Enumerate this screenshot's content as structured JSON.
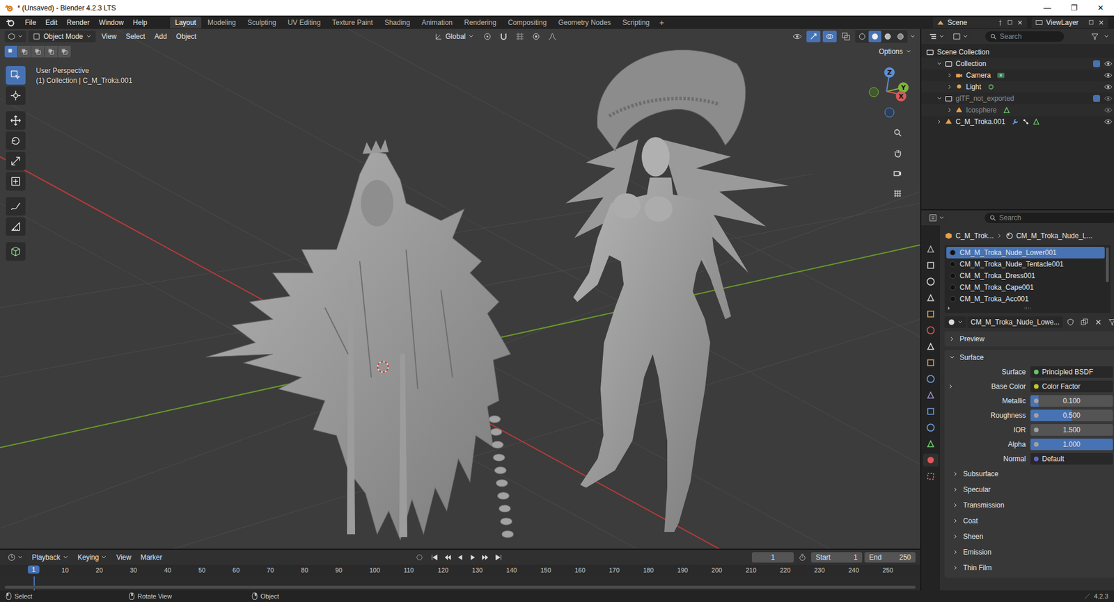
{
  "window": {
    "title": "* (Unsaved) - Blender 4.2.3 LTS",
    "controls": [
      "—",
      "❐",
      "✕"
    ]
  },
  "menus": [
    "File",
    "Edit",
    "Render",
    "Window",
    "Help"
  ],
  "workspaces": [
    {
      "label": "Layout",
      "selected": true
    },
    {
      "label": "Modeling",
      "selected": false
    },
    {
      "label": "Sculpting",
      "selected": false
    },
    {
      "label": "UV Editing",
      "selected": false
    },
    {
      "label": "Texture Paint",
      "selected": false
    },
    {
      "label": "Shading",
      "selected": false
    },
    {
      "label": "Animation",
      "selected": false
    },
    {
      "label": "Rendering",
      "selected": false
    },
    {
      "label": "Compositing",
      "selected": false
    },
    {
      "label": "Geometry Nodes",
      "selected": false
    },
    {
      "label": "Scripting",
      "selected": false
    }
  ],
  "workspace_add": "+",
  "scene": {
    "name": "Scene",
    "view_layer": "ViewLayer"
  },
  "viewport": {
    "mode": "Object Mode",
    "menus": [
      "View",
      "Select",
      "Add",
      "Object"
    ],
    "orientation": "Global",
    "options": "Options",
    "perspective": "User Perspective",
    "context": "(1) Collection | C_M_Troka.001",
    "gizmo": {
      "z": "Z",
      "y": "Y",
      "x": "X"
    },
    "tools": [
      {
        "selected": true
      },
      {
        "selected": false
      },
      {
        "selected": false
      },
      {
        "selected": false
      },
      {
        "selected": false
      },
      {
        "selected": false
      },
      {
        "selected": false
      },
      {
        "selected": false
      },
      {
        "selected": false
      }
    ],
    "select_modes": [
      {
        "selected": true
      },
      {
        "selected": false
      },
      {
        "selected": false
      },
      {
        "selected": false
      },
      {
        "selected": false
      }
    ],
    "shading": [
      {
        "selected": false
      },
      {
        "selected": true
      },
      {
        "selected": false
      },
      {
        "selected": false
      }
    ]
  },
  "timeline": {
    "menus": [
      "Playback",
      "Keying",
      "View",
      "Marker"
    ],
    "frame": "1",
    "start_label": "Start",
    "start": "1",
    "end_label": "End",
    "end": "250",
    "current": "1",
    "ruler": [
      "10",
      "20",
      "30",
      "40",
      "50",
      "60",
      "70",
      "80",
      "90",
      "100",
      "110",
      "120",
      "130",
      "140",
      "150",
      "160",
      "170",
      "180",
      "190",
      "200",
      "210",
      "220",
      "230",
      "240",
      "250"
    ]
  },
  "outliner": {
    "search": "Search",
    "tree": [
      {
        "label": "Scene Collection",
        "kind": "scene",
        "children": [
          {
            "label": "Collection",
            "kind": "collection",
            "expanded": true,
            "checked": true,
            "visible": true,
            "renderable": true,
            "dimmed": false,
            "children": [
              {
                "label": "Camera",
                "kind": "camera",
                "expanded": false,
                "visible": true,
                "renderable": true,
                "dimmed": false
              },
              {
                "label": "Light",
                "kind": "light",
                "expanded": false,
                "visible": true,
                "renderable": true,
                "dimmed": false
              }
            ]
          },
          {
            "label": "glTF_not_exported",
            "kind": "collection",
            "expanded": true,
            "checked": true,
            "visible": true,
            "renderable": false,
            "dimmed": true,
            "children": [
              {
                "label": "Icosphere",
                "kind": "mesh",
                "expanded": false,
                "visible": true,
                "renderable": false,
                "dimmed": true
              }
            ]
          },
          {
            "label": "C_M_Troka.001",
            "kind": "rig",
            "expanded": false,
            "visible": true,
            "renderable": true,
            "dimmed": false
          }
        ]
      }
    ]
  },
  "properties": {
    "search": "Search",
    "tabs": [
      {
        "selected": false
      },
      {
        "selected": false
      },
      {
        "selected": false
      },
      {
        "selected": false
      },
      {
        "selected": false
      },
      {
        "selected": false
      },
      {
        "selected": false
      },
      {
        "selected": false
      },
      {
        "selected": false
      },
      {
        "selected": false
      },
      {
        "selected": false
      },
      {
        "selected": false
      },
      {
        "selected": false
      },
      {
        "selected": true
      },
      {
        "selected": false
      }
    ],
    "breadcrumb": {
      "object": "C_M_Trok...",
      "material": "CM_M_Troka_Nude_L..."
    },
    "slots": [
      {
        "label": "CM_M_Troka_Nude_Lower001",
        "selected": true
      },
      {
        "label": "CM_M_Troka_Nude_Tentacle001",
        "selected": false
      },
      {
        "label": "CM_M_Troka_Dress001",
        "selected": false
      },
      {
        "label": "CM_M_Troka_Cape001",
        "selected": false
      },
      {
        "label": "CM_M_Troka_Acc001",
        "selected": false
      }
    ],
    "material": "CM_M_Troka_Nude_Lowe...",
    "panels": [
      {
        "label": "Preview",
        "expanded": false
      },
      {
        "label": "Surface",
        "expanded": true
      }
    ],
    "fields": [
      {
        "label": "Surface",
        "kind": "link",
        "value": "Principled BSDF",
        "color": "#63c763",
        "expandable": false
      },
      {
        "label": "Base Color",
        "kind": "link",
        "value": "Color Factor",
        "color": "#c7c729",
        "expandable": true,
        "expanded": false
      },
      {
        "label": "Metallic",
        "kind": "slider",
        "value": "0.100",
        "level": 0.1,
        "color": "#a1a1a1",
        "expandable": false
      },
      {
        "label": "Roughness",
        "kind": "slider",
        "value": "0.500",
        "level": 0.5,
        "color": "#a1a1a1",
        "expandable": false
      },
      {
        "label": "IOR",
        "kind": "number",
        "value": "1.500",
        "color": "#a1a1a1",
        "expandable": false
      },
      {
        "label": "Alpha",
        "kind": "slider",
        "value": "1.000",
        "level": 1.0,
        "color": "#a1a1a1",
        "expandable": false
      },
      {
        "label": "Normal",
        "kind": "link",
        "value": "Default",
        "color": "#6363c7",
        "expandable": false
      }
    ],
    "subpanels": [
      {
        "label": "Subsurface",
        "expanded": false
      },
      {
        "label": "Specular",
        "expanded": false
      },
      {
        "label": "Transmission",
        "expanded": false
      },
      {
        "label": "Coat",
        "expanded": false
      },
      {
        "label": "Sheen",
        "expanded": false
      },
      {
        "label": "Emission",
        "expanded": false
      },
      {
        "label": "Thin Film",
        "expanded": false
      }
    ]
  },
  "status": {
    "items": [
      "Select",
      "Rotate View",
      "Object"
    ],
    "version": "4.2.3"
  }
}
